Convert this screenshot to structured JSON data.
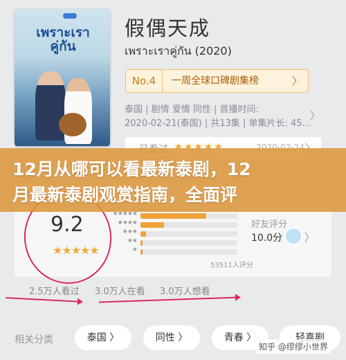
{
  "show": {
    "title": "假偶天成",
    "original_title": "เพราะเราคู่กัน (2020)",
    "poster_title": "เพราะเรา คู่กัน",
    "rank": {
      "number": "No.4",
      "label": "一周全球口碑剧集榜",
      "chevron": "〉"
    },
    "meta_line1": "泰国 | 剧情 爱情 同性 | 首播时间:",
    "meta_line2": "2020-02-21(泰国) | 共13集 | 单集片长: 45...",
    "meta_chevron": "〉",
    "watched": {
      "label": "已看过",
      "stars": "★★★★★",
      "date": "2020-02-24",
      "chevron": "〉"
    }
  },
  "banner": {
    "line1": "12月从哪可以看最新泰剧，12",
    "line2": "月最新泰剧观赏指南，全面评"
  },
  "rating": {
    "score": "9.2",
    "stars": "★★★★★",
    "distribution": [
      {
        "stars": "★★★★★",
        "fraction": 0.68
      },
      {
        "stars": "★★★★",
        "fraction": 0.24
      },
      {
        "stars": "★★★",
        "fraction": 0.06
      },
      {
        "stars": "★★",
        "fraction": 0.02
      },
      {
        "stars": "★",
        "fraction": 0.02
      }
    ],
    "count": "53511人评分",
    "friend_label": "好友评分",
    "friend_score": "10.0分",
    "friend_chevron": "〉"
  },
  "stats": {
    "watched": "2.5万人看过",
    "watching": "3.0万人在看",
    "want": "3.0万人想看"
  },
  "tags": {
    "label": "相关分类",
    "items": [
      "泰国 〉",
      "同性 〉",
      "青春 〉",
      "轻喜剧"
    ]
  },
  "watermark": "知乎 @缪缪小世界",
  "colors": {
    "accent": "#f1a93c",
    "annotation": "#d92a5b",
    "banner": "#dc963c"
  }
}
